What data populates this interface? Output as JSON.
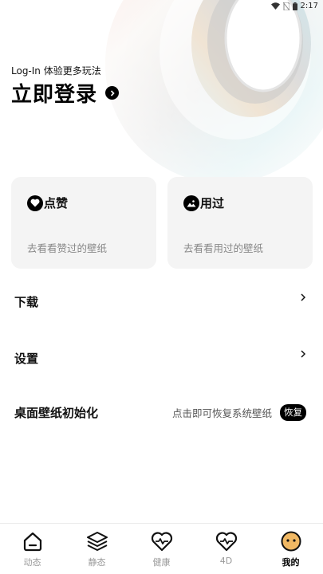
{
  "status_bar": {
    "time": "2:17",
    "icons": [
      "wifi-icon",
      "no-sim-icon",
      "battery-icon"
    ]
  },
  "header": {
    "login_subtitle": "Log-In 体验更多玩法",
    "login_title": "立即登录",
    "arrow_icon": "chevron-right-circle-icon"
  },
  "cards": [
    {
      "title": "点赞",
      "description": "去看看赞过的壁纸",
      "icon": "heart-icon"
    },
    {
      "title": "用过",
      "description": "去看看用过的壁纸",
      "icon": "image-icon"
    }
  ],
  "menu": {
    "download_label": "下载",
    "settings_label": "设置",
    "reset_label": "桌面壁纸初始化",
    "reset_hint": "点击即可恢复系统壁纸",
    "reset_button": "恢复"
  },
  "tabbar": {
    "tabs": [
      {
        "label": "动态",
        "icon": "home-icon",
        "active": false
      },
      {
        "label": "静态",
        "icon": "layers-icon",
        "active": false
      },
      {
        "label": "健康",
        "icon": "heart-pulse-icon",
        "active": false
      },
      {
        "label": "4D",
        "icon": "heart-pulse-icon",
        "active": false
      },
      {
        "label": "我的",
        "icon": "smiley-face-icon",
        "active": true
      }
    ]
  },
  "colors": {
    "accent": "#000000",
    "card_bg": "#f4f4f4",
    "muted_text": "#888888",
    "inactive_tab": "#999999"
  }
}
